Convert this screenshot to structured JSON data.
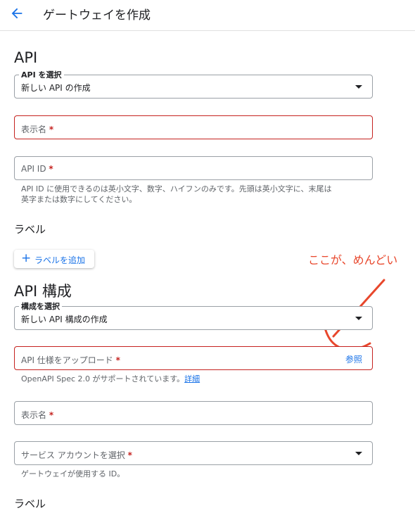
{
  "header": {
    "title": "ゲートウェイを作成",
    "back_icon": "arrow-left-icon"
  },
  "api_section": {
    "heading": "API",
    "select_label": "API を選択",
    "select_value": "新しい API の作成",
    "display_name_placeholder": "表示名",
    "api_id_placeholder": "API ID",
    "api_id_hint_line1": "API ID に使用できるのは英小文字、数字、ハイフンのみです。先頭は英小文字に、末尾は",
    "api_id_hint_line2": "英字または数字にしてください。",
    "labels_heading": "ラベル",
    "add_label_button": "ラベルを追加"
  },
  "annotation": {
    "text": "ここが、めんどい",
    "color": "#e8472c"
  },
  "config_section": {
    "heading": "API 構成",
    "select_label": "構成を選択",
    "select_value": "新しい API 構成の作成",
    "spec_upload_placeholder": "API 仕様をアップロード",
    "browse_button": "参照",
    "spec_hint": "OpenAPI Spec 2.0 がサポートされています。",
    "spec_hint_link": "詳細",
    "display_name_placeholder": "表示名",
    "service_account_placeholder": "サービス アカウントを選択",
    "service_account_hint": "ゲートウェイが使用する ID。",
    "labels_heading": "ラベル"
  },
  "required_marker": "*",
  "colors": {
    "accent": "#1a73e8",
    "error": "#c5221f"
  }
}
